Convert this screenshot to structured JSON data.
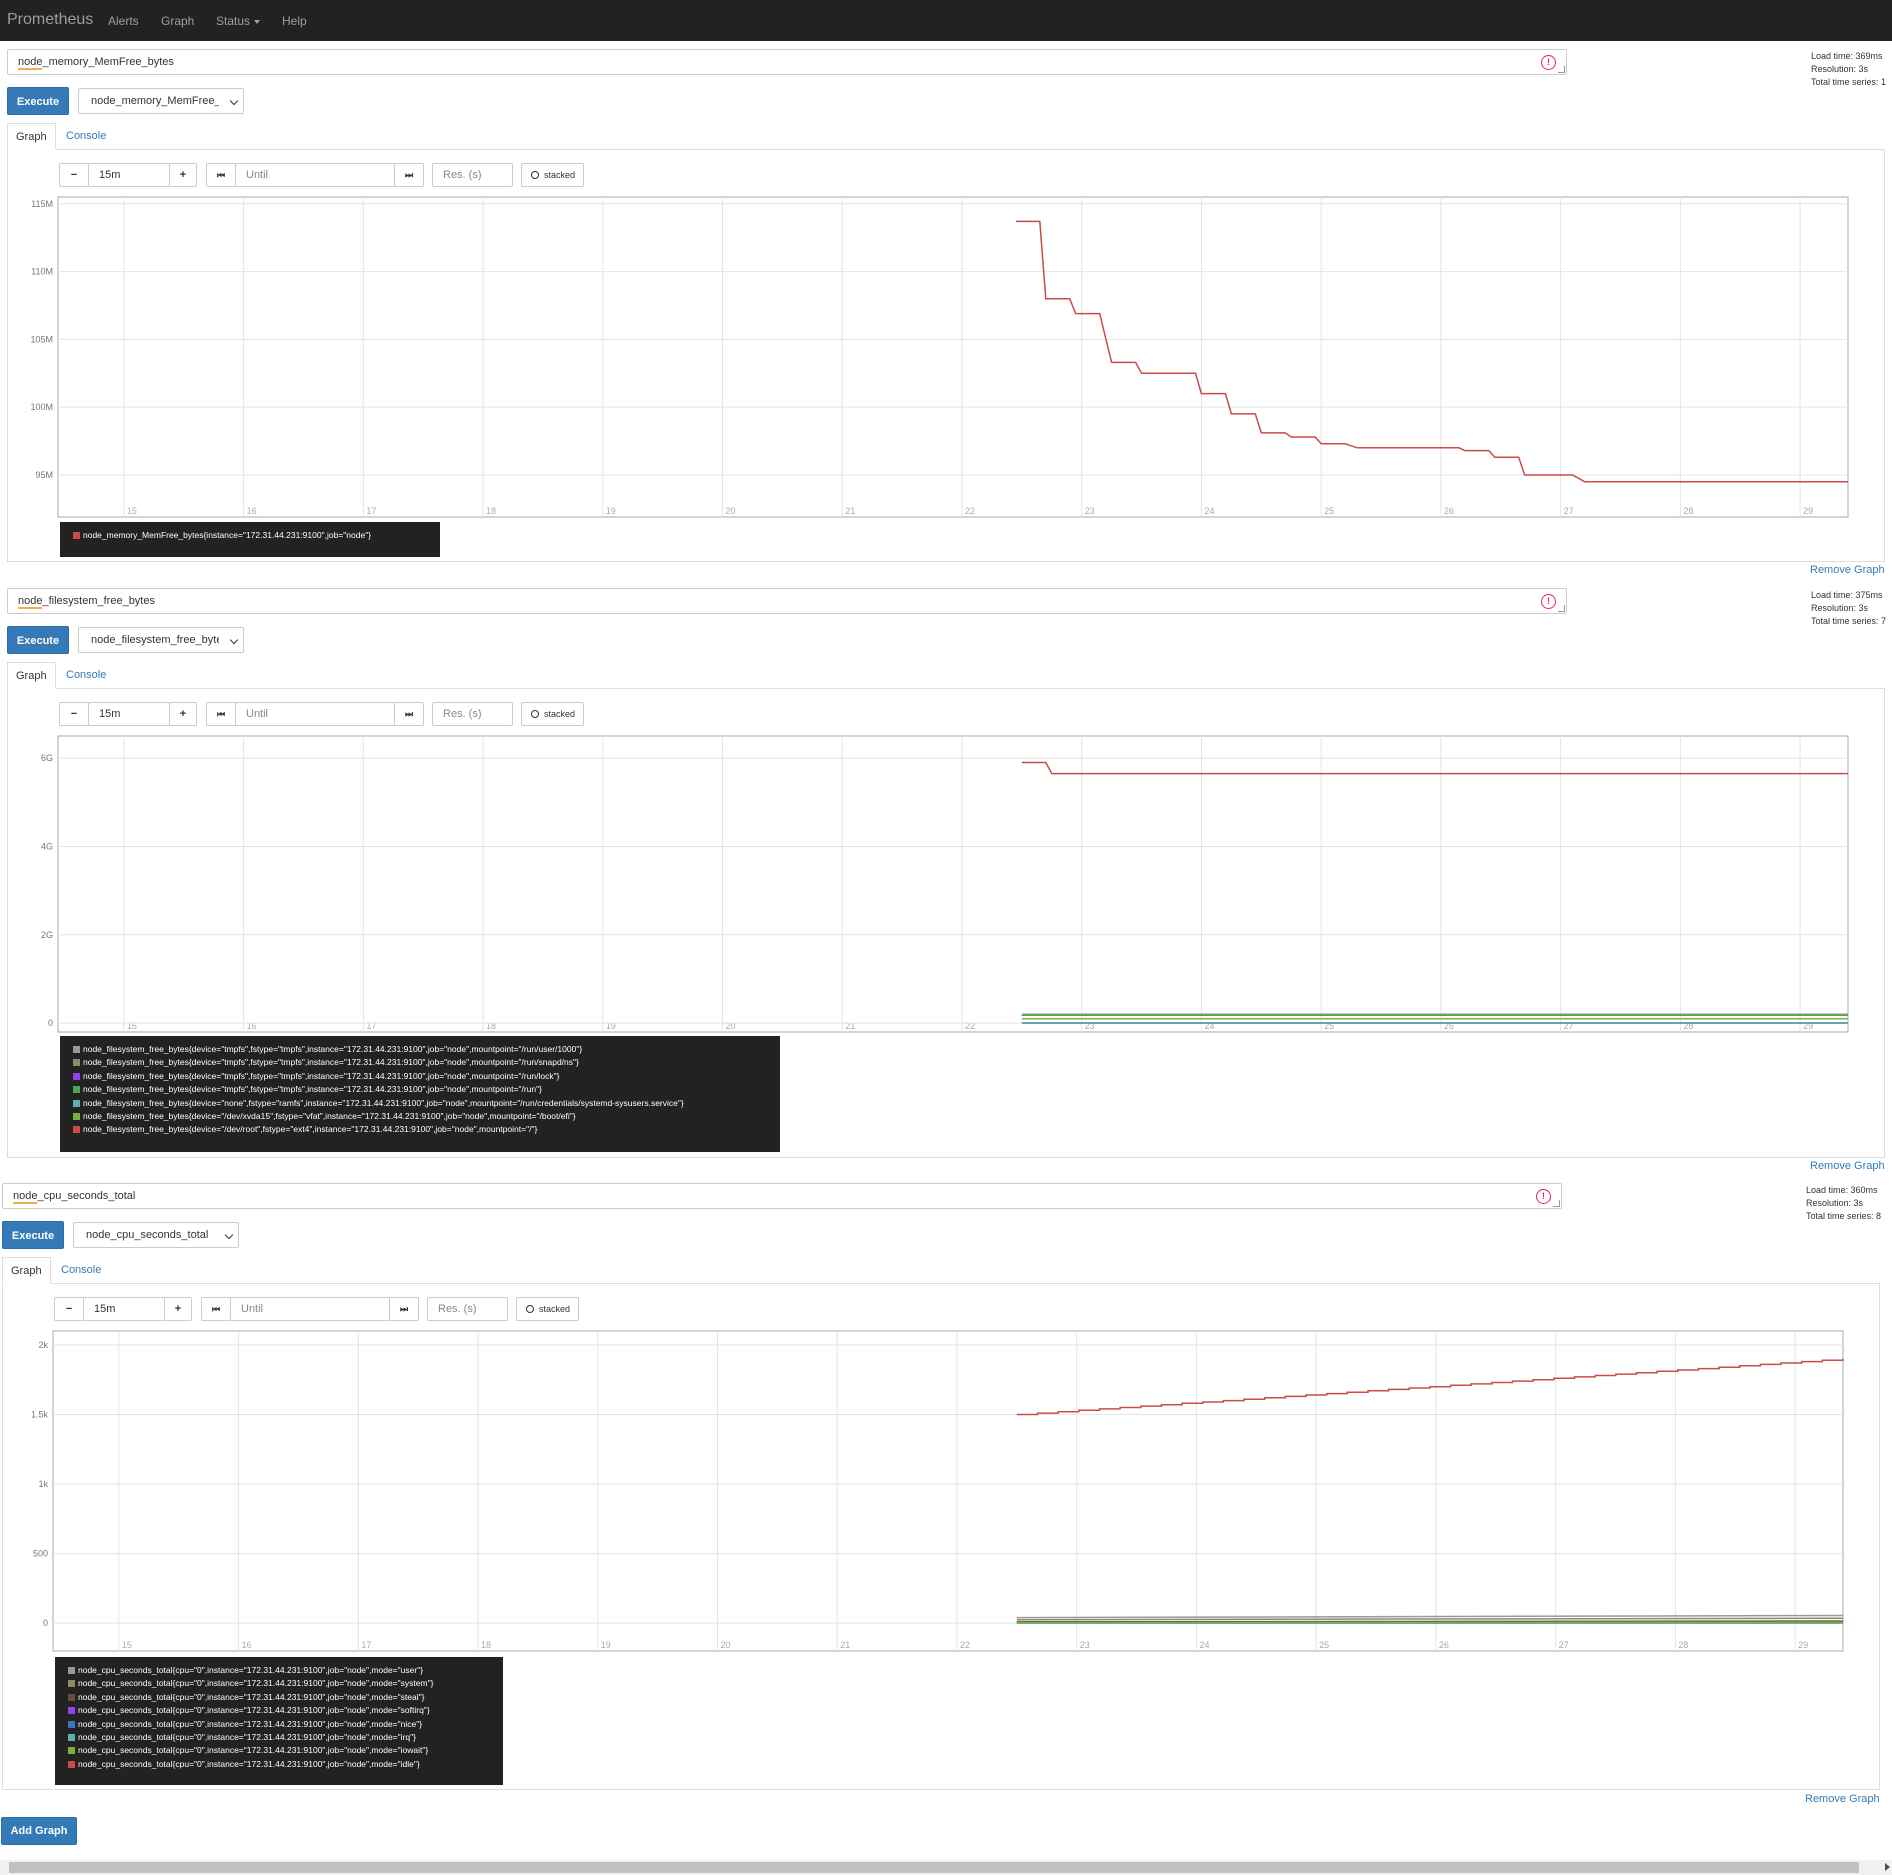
{
  "nav": {
    "brand": "Prometheus",
    "alerts": "Alerts",
    "graph": "Graph",
    "status": "Status",
    "help": "Help"
  },
  "common": {
    "execute": "Execute",
    "tab_graph": "Graph",
    "tab_console": "Console",
    "minus": "−",
    "plus": "+",
    "range": "15m",
    "back": "⏮",
    "fwd": "⏭",
    "until_placeholder": "Until",
    "res_placeholder": "Res. (s)",
    "stacked": "stacked",
    "remove_graph": "Remove Graph",
    "add_graph": "Add Graph"
  },
  "panels": [
    {
      "expr_prefix": "node",
      "expr_suffix": "_memory_MemFree_bytes",
      "select_value": "node_memory_MemFree_bytes",
      "load_time": "Load time: 369ms",
      "resolution": "Resolution: 3s",
      "total_series": "Total time series: 1",
      "chart_data": {
        "type": "line",
        "x_ticks": [
          "15",
          "16",
          "17",
          "18",
          "19",
          "20",
          "21",
          "22",
          "23",
          "24",
          "25",
          "26",
          "27",
          "28",
          "29"
        ],
        "y_ticks": [
          "115M",
          "110M",
          "105M",
          "100M",
          "95M"
        ],
        "y_tick_values": [
          115,
          110,
          105,
          100,
          95
        ],
        "ylim": [
          91.9,
          115.5
        ],
        "xlim": [
          14.45,
          29.4
        ],
        "series": [
          {
            "name": "node_memory_MemFree_bytes{instance=\"172.31.44.231:9100\",job=\"node\"}",
            "color": "#cb4b4b",
            "x": [
              22.45,
              22.65,
              22.7,
              22.9,
              22.95,
              23.15,
              23.25,
              23.45,
              23.5,
              23.95,
              24.0,
              24.2,
              24.25,
              24.45,
              24.5,
              24.7,
              24.75,
              24.95,
              25.0,
              25.2,
              25.3,
              26.15,
              26.2,
              26.4,
              26.45,
              26.65,
              26.7,
              27.1,
              27.2,
              29.4
            ],
            "y": [
              113.7,
              113.7,
              108.0,
              108.0,
              106.9,
              106.9,
              103.3,
              103.3,
              102.5,
              102.5,
              101.0,
              101.0,
              99.5,
              99.5,
              98.1,
              98.1,
              97.8,
              97.8,
              97.3,
              97.3,
              97.0,
              97.0,
              96.8,
              96.8,
              96.3,
              96.3,
              95.0,
              95.0,
              94.5,
              94.5
            ]
          }
        ]
      }
    },
    {
      "expr_prefix": "node",
      "expr_suffix": "_filesystem_free_bytes",
      "select_value": "node_filesystem_free_bytes",
      "load_time": "Load time: 375ms",
      "resolution": "Resolution: 3s",
      "total_series": "Total time series: 7",
      "chart_data": {
        "type": "line",
        "x_ticks": [
          "15",
          "16",
          "17",
          "18",
          "19",
          "20",
          "21",
          "22",
          "23",
          "24",
          "25",
          "26",
          "27",
          "28",
          "29"
        ],
        "y_ticks": [
          "6G",
          "4G",
          "2G",
          "0"
        ],
        "y_tick_values": [
          6,
          4,
          2,
          0
        ],
        "ylim": [
          -0.2,
          6.5
        ],
        "xlim": [
          14.45,
          29.4
        ],
        "series": [
          {
            "name": "node_filesystem_free_bytes{device=\"tmpfs\",fstype=\"tmpfs\",instance=\"172.31.44.231:9100\",job=\"node\",mountpoint=\"/run/user/1000\"}",
            "color": "#999999",
            "x": [
              22.5,
              29.4
            ],
            "y": [
              0.2,
              0.2
            ]
          },
          {
            "name": "node_filesystem_free_bytes{device=\"tmpfs\",fstype=\"tmpfs\",instance=\"172.31.44.231:9100\",job=\"node\",mountpoint=\"/run/snapd/ns\"}",
            "color": "#8c8c6b",
            "x": [
              22.5,
              29.4
            ],
            "y": [
              0.18,
              0.18
            ]
          },
          {
            "name": "node_filesystem_free_bytes{device=\"tmpfs\",fstype=\"tmpfs\",instance=\"172.31.44.231:9100\",job=\"node\",mountpoint=\"/run/lock\"}",
            "color": "#9440ed",
            "x": [
              22.5,
              29.4
            ],
            "y": [
              0.005,
              0.005
            ]
          },
          {
            "name": "node_filesystem_free_bytes{device=\"tmpfs\",fstype=\"tmpfs\",instance=\"172.31.44.231:9100\",job=\"node\",mountpoint=\"/run\"}",
            "color": "#4da74d",
            "x": [
              22.5,
              29.4
            ],
            "y": [
              0.18,
              0.18
            ]
          },
          {
            "name": "node_filesystem_free_bytes{device=\"none\",fstype=\"ramfs\",instance=\"172.31.44.231:9100\",job=\"node\",mountpoint=\"/run/credentials/systemd-sysusers.service\"}",
            "color": "#5ab1a8",
            "x": [
              22.5,
              29.4
            ],
            "y": [
              0,
              0
            ]
          },
          {
            "name": "node_filesystem_free_bytes{device=\"/dev/xvda15\",fstype=\"vfat\",instance=\"172.31.44.231:9100\",job=\"node\",mountpoint=\"/boot/efi\"}",
            "color": "#7ab03c",
            "x": [
              22.5,
              29.4
            ],
            "y": [
              0.1,
              0.1
            ]
          },
          {
            "name": "node_filesystem_free_bytes{device=\"/dev/root\",fstype=\"ext4\",instance=\"172.31.44.231:9100\",job=\"node\",mountpoint=\"/\"}",
            "color": "#cb4b4b",
            "x": [
              22.5,
              22.7,
              22.75,
              29.4
            ],
            "y": [
              5.9,
              5.9,
              5.65,
              5.65
            ]
          }
        ]
      }
    },
    {
      "expr_prefix": "node",
      "expr_suffix": "_cpu_seconds_total",
      "select_value": "node_cpu_seconds_total",
      "load_time": "Load time: 360ms",
      "resolution": "Resolution: 3s",
      "total_series": "Total time series: 8",
      "chart_data": {
        "type": "line",
        "x_ticks": [
          "15",
          "16",
          "17",
          "18",
          "19",
          "20",
          "21",
          "22",
          "23",
          "24",
          "25",
          "26",
          "27",
          "28",
          "29"
        ],
        "y_ticks": [
          "2k",
          "1.5k",
          "1k",
          "500",
          "0"
        ],
        "y_tick_values": [
          2000,
          1500,
          1000,
          500,
          0
        ],
        "ylim": [
          -200,
          2100
        ],
        "xlim": [
          14.45,
          29.4
        ],
        "series": [
          {
            "name": "node_cpu_seconds_total{cpu=\"0\",instance=\"172.31.44.231:9100\",job=\"node\",mode=\"user\"}",
            "color": "#999999",
            "x": [
              22.5,
              29.4
            ],
            "y": [
              40,
              55
            ]
          },
          {
            "name": "node_cpu_seconds_total{cpu=\"0\",instance=\"172.31.44.231:9100\",job=\"node\",mode=\"system\"}",
            "color": "#8c8c6b",
            "x": [
              22.5,
              29.4
            ],
            "y": [
              25,
              35
            ]
          },
          {
            "name": "node_cpu_seconds_total{cpu=\"0\",instance=\"172.31.44.231:9100\",job=\"node\",mode=\"steal\"}",
            "color": "#6b4c3b",
            "x": [
              22.5,
              29.4
            ],
            "y": [
              10,
              15
            ]
          },
          {
            "name": "node_cpu_seconds_total{cpu=\"0\",instance=\"172.31.44.231:9100\",job=\"node\",mode=\"softirq\"}",
            "color": "#9440ed",
            "x": [
              22.5,
              29.4
            ],
            "y": [
              2,
              3
            ]
          },
          {
            "name": "node_cpu_seconds_total{cpu=\"0\",instance=\"172.31.44.231:9100\",job=\"node\",mode=\"nice\"}",
            "color": "#337ab7",
            "x": [
              22.5,
              29.4
            ],
            "y": [
              0,
              0
            ]
          },
          {
            "name": "node_cpu_seconds_total{cpu=\"0\",instance=\"172.31.44.231:9100\",job=\"node\",mode=\"irq\"}",
            "color": "#5ab1a8",
            "x": [
              22.5,
              29.4
            ],
            "y": [
              0,
              0
            ]
          },
          {
            "name": "node_cpu_seconds_total{cpu=\"0\",instance=\"172.31.44.231:9100\",job=\"node\",mode=\"iowait\"}",
            "color": "#7ab03c",
            "x": [
              22.5,
              29.4
            ],
            "y": [
              5,
              7
            ]
          },
          {
            "name": "node_cpu_seconds_total{cpu=\"0\",instance=\"172.31.44.231:9100\",job=\"node\",mode=\"idle\"}",
            "color": "#cb4b4b",
            "x": [
              22.5,
              29.4
            ],
            "y": [
              1500,
              1900
            ],
            "stepped": true
          }
        ]
      }
    }
  ]
}
